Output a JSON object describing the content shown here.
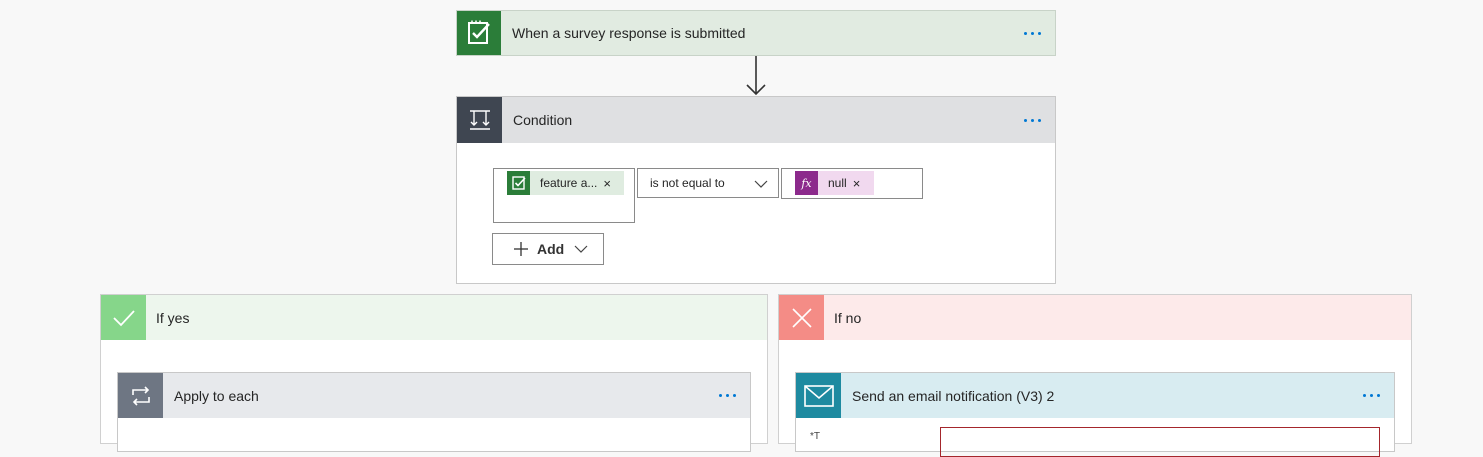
{
  "trigger": {
    "title": "When a survey response is submitted",
    "icon": "survey-icon"
  },
  "condition": {
    "title": "Condition",
    "icon": "condition-icon",
    "left_token": {
      "label": "feature a...",
      "remove": "×",
      "icon": "survey-icon"
    },
    "operator": "is not equal to",
    "right_token": {
      "label": "null",
      "remove": "×",
      "icon": "fx",
      "icon_text": "fx"
    },
    "add_label": "Add"
  },
  "branches": {
    "yes": {
      "label": "If yes",
      "color": "#86d68a"
    },
    "no": {
      "label": "If no",
      "color": "#f48c86"
    }
  },
  "apply_each": {
    "title": "Apply to each",
    "icon": "loop-icon"
  },
  "email": {
    "title": "Send an email notification (V3) 2",
    "icon": "mail-icon",
    "field_label": "*T"
  },
  "colors": {
    "accent": "#0078d4",
    "trigger": "#2b7d39",
    "condition": "#3f4651",
    "fx": "#8c2a8c",
    "mail": "#1e8aa0"
  }
}
